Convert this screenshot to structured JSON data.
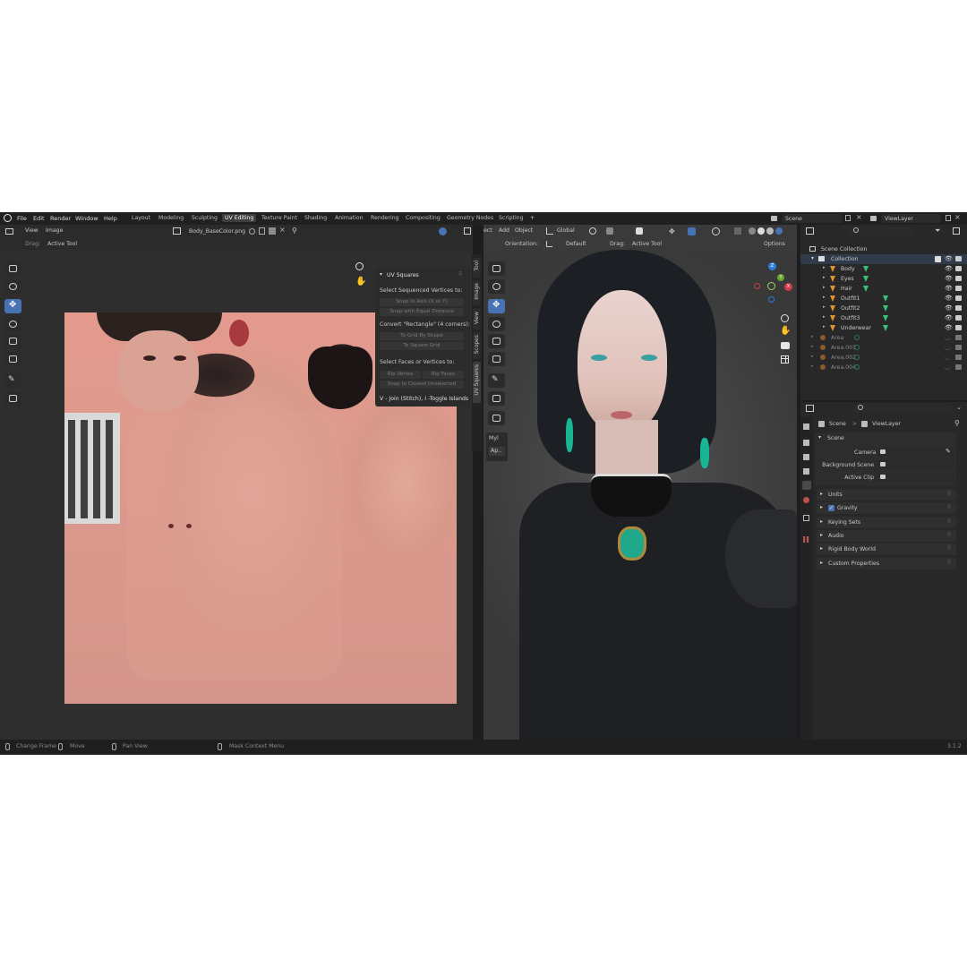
{
  "menubar": {
    "items": [
      "File",
      "Edit",
      "Render",
      "Window",
      "Help"
    ],
    "workspaces": [
      "Layout",
      "Modeling",
      "Sculpting",
      "UV Editing",
      "Texture Paint",
      "Shading",
      "Animation",
      "Rendering",
      "Compositing",
      "Geometry Nodes",
      "Scripting"
    ],
    "active_workspace": "UV Editing",
    "add_label": "+",
    "scene_name": "Scene",
    "view_layer_name": "ViewLayer"
  },
  "uv_editor": {
    "menus": [
      "View",
      "Image"
    ],
    "image_name": "Body_BaseColor.png",
    "drag_label": "Drag:",
    "drag_value": "Active Tool"
  },
  "uv_squares_panel": {
    "title": "UV Squares",
    "section1": "Select Sequenced Vertices to:",
    "btn_snap_axis": "Snap to Axis (X or Y)",
    "btn_snap_equal": "Snap with Equal Distance",
    "section2": "Convert \"Rectangle\" (4 corners):",
    "btn_grid_shape": "To Grid By Shape",
    "btn_square_grid": "To Square Grid",
    "section3": "Select Faces or Vertices to:",
    "btn_rip_vertex": "Rip Vertex",
    "btn_rip_faces": "Rip Faces",
    "btn_snap_closest": "Snap to Closest Unselected",
    "footer": "V - Join (Stitch), I -Toggle Islands"
  },
  "sidebar_tabs": [
    "Tool",
    "Image",
    "View",
    "Scopes",
    "UV Squares"
  ],
  "viewport": {
    "menus_partial": "ect",
    "menus": [
      "Add",
      "Object"
    ],
    "transform_orientation": "Global",
    "orientation_label": "Orientation:",
    "orientation_value": "Default",
    "drag_label": "Drag:",
    "drag_value": "Active Tool",
    "options_label": "Options",
    "mini_panel_title": "Myl",
    "mini_panel_btn": "Ap..",
    "axis_labels": [
      "Z",
      "Y",
      "X"
    ]
  },
  "outliner": {
    "root": "Scene Collection",
    "collection": "Collection",
    "objects": [
      "Body",
      "Eyes",
      "Hair",
      "Outfit1",
      "Outfit2",
      "Outfit3",
      "Underwear"
    ],
    "lights": [
      "Area",
      "Area.001",
      "Area.002",
      "Area.004"
    ]
  },
  "properties": {
    "breadcrumb_scene": "Scene",
    "breadcrumb_sep": ">",
    "breadcrumb_layer": "ViewLayer",
    "panel_scene": "Scene",
    "camera_label": "Camera",
    "background_label": "Background Scene",
    "active_clip_label": "Active Clip",
    "sections": [
      "Units",
      "Gravity",
      "Keying Sets",
      "Audio",
      "Rigid Body World",
      "Custom Properties"
    ],
    "gravity_checked": true
  },
  "statusbar": {
    "change_frame": "Change Frame",
    "move": "Move",
    "pan_view": "Pan View",
    "mask_context": "Mask Context Menu",
    "version": "3.1.2"
  },
  "colors": {
    "accent_blue": "#4772b3",
    "panel_bg": "#2b2b2b",
    "object_orange": "#e0922e",
    "mesh_green": "#35c27a"
  }
}
